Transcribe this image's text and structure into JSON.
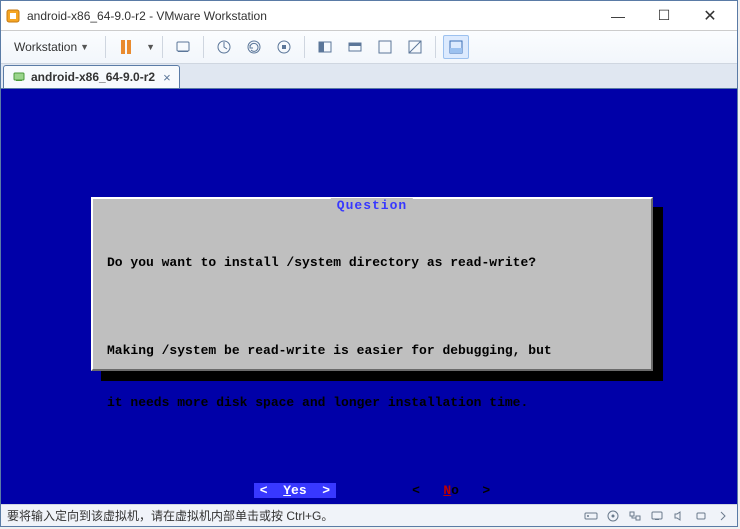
{
  "window": {
    "title": "android-x86_64-9.0-r2 - VMware Workstation"
  },
  "toolbar": {
    "workstation_menu_label": "Workstation"
  },
  "tab": {
    "label": "android-x86_64-9.0-r2",
    "close": "×"
  },
  "dialog": {
    "title": "Question",
    "line1": "Do you want to install /system directory as read-write?",
    "line2": "Making /system be read-write is easier for debugging, but",
    "line3": "it needs more disk space and longer installation time.",
    "yes_bracket_l": "<",
    "yes_label_u": "Y",
    "yes_label_rest": "es",
    "yes_bracket_r": ">",
    "no_bracket_l": "<",
    "no_label_u": "N",
    "no_label_rest": "o",
    "no_bracket_r": ">"
  },
  "statusbar": {
    "text": "要将输入定向到该虚拟机，请在虚拟机内部单击或按 Ctrl+G。"
  }
}
